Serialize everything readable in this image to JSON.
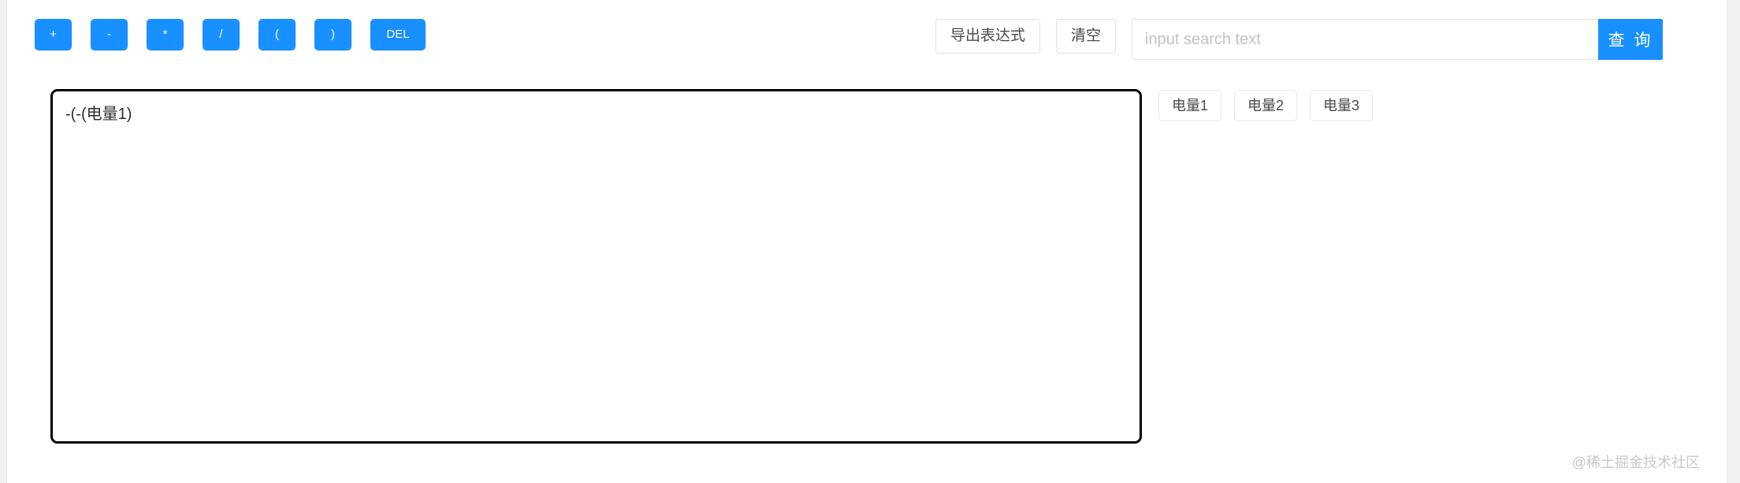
{
  "colors": {
    "primary": "#1890ff",
    "page_background": "#f1f2f4",
    "card_background": "#ffffff",
    "editor_border": "#000000",
    "ghost_border": "#e2e2e2",
    "placeholder_text": "#c3c3c3",
    "watermark_text": "#c9c9c9"
  },
  "toolbar": {
    "operators": [
      {
        "label": "+",
        "name": "plus"
      },
      {
        "label": "-",
        "name": "minus"
      },
      {
        "label": "*",
        "name": "multiply"
      },
      {
        "label": "/",
        "name": "divide"
      },
      {
        "label": "(",
        "name": "paren-open"
      },
      {
        "label": ")",
        "name": "paren-close"
      },
      {
        "label": "DEL",
        "name": "delete"
      }
    ]
  },
  "actions": {
    "export_label": "导出表达式",
    "clear_label": "清空"
  },
  "search": {
    "value": "",
    "placeholder": "input search text",
    "button_label": "查 询"
  },
  "tags": [
    {
      "label": "电量1"
    },
    {
      "label": "电量2"
    },
    {
      "label": "电量3"
    }
  ],
  "editor": {
    "expression": "-(-(电量1)"
  },
  "watermark": {
    "text": "@稀土掘金技术社区"
  }
}
